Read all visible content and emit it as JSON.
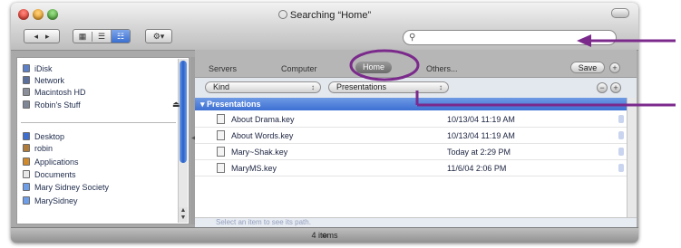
{
  "window": {
    "title": "Searching “Home”",
    "status": "4 items"
  },
  "toolbar": {
    "back_label": "◂",
    "forward_label": "▸",
    "view_icons": [
      "grid-icon",
      "list-icon",
      "column-icon"
    ],
    "action_label": "⚙▾",
    "search_placeholder": ""
  },
  "sidebar": {
    "devices": [
      {
        "label": "iDisk",
        "icon": "idisk-icon",
        "color": "#5c7fc8"
      },
      {
        "label": "Network",
        "icon": "network-icon",
        "color": "#5a6f9b"
      },
      {
        "label": "Macintosh HD",
        "icon": "hard-disk-icon",
        "color": "#8a8f99"
      },
      {
        "label": "Robin's Stuff",
        "icon": "disk-icon",
        "color": "#7f8796",
        "eject": "⏏"
      }
    ],
    "places": [
      {
        "label": "Desktop",
        "icon": "desktop-icon",
        "color": "#3e6fd0"
      },
      {
        "label": "robin",
        "icon": "home-icon",
        "color": "#b07a38"
      },
      {
        "label": "Applications",
        "icon": "applications-icon",
        "color": "#d08a2c"
      },
      {
        "label": "Documents",
        "icon": "documents-icon",
        "color": "#e8e8e8"
      },
      {
        "label": "Mary Sidney Society",
        "icon": "folder-icon",
        "color": "#6f9ee8"
      },
      {
        "label": "MarySidney",
        "icon": "folder-icon",
        "color": "#6f9ee8"
      }
    ]
  },
  "scopes": {
    "items": [
      "Servers",
      "Computer",
      "Home",
      "Others..."
    ],
    "selected": "Home",
    "save_label": "Save",
    "add_label": "+"
  },
  "criteria": {
    "attribute": "Kind",
    "value": "Presentations",
    "remove_label": "−",
    "add_label": "+"
  },
  "results": {
    "group": "▾ Presentations",
    "rows": [
      {
        "name": "About Drama.key",
        "date": "10/13/04 11:19 AM"
      },
      {
        "name": "About Words.key",
        "date": "10/13/04 11:19 AM"
      },
      {
        "name": "Mary~Shak.key",
        "date": "Today at 2:29 PM"
      },
      {
        "name": "MaryMS.key",
        "date": "11/6/04 2:06 PM"
      }
    ]
  },
  "path_hint": "Select an item to see its path.",
  "accent": "#7b2a8c"
}
